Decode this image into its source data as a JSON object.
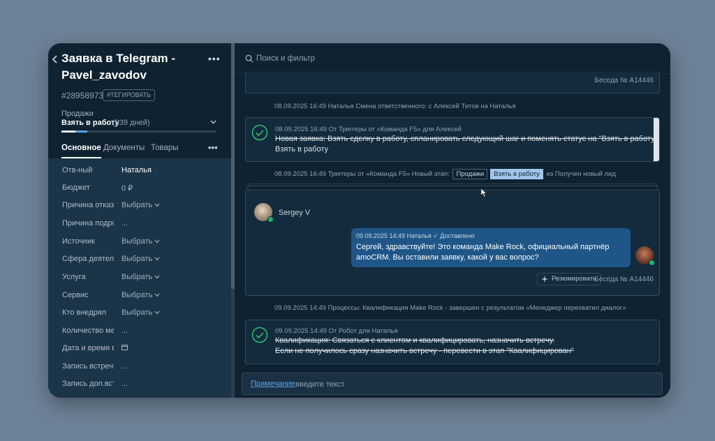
{
  "deal": {
    "title": "Заявка в Telegram - Pavel_zavodov",
    "id": "#28958973",
    "tag_button": "#ТЕГИРОВАТЬ",
    "pipeline": "Продажи",
    "stage": "Взять в работу",
    "stage_days": "(239 дней)",
    "more": "•••"
  },
  "tabs": [
    {
      "label": "Основное",
      "active": true
    },
    {
      "label": "Документы",
      "active": false
    },
    {
      "label": "Товары",
      "active": false
    }
  ],
  "tabs_more": "•••",
  "fields": [
    {
      "label": "Отв-ный",
      "value": "Наталья"
    },
    {
      "label": "Бюджет",
      "value": "0 ₽"
    },
    {
      "label": "Причина отказа",
      "value": "Выбрать"
    },
    {
      "label": "Причина подробно",
      "value": "..."
    },
    {
      "label": "Источник",
      "value": "Выбрать"
    },
    {
      "label": "Сфера деятельности",
      "value": "Выбрать"
    },
    {
      "label": "Услуга",
      "value": "Выбрать"
    },
    {
      "label": "Сервис",
      "value": "Выбрать"
    },
    {
      "label": "Кто внедрял",
      "value": "Выбрать"
    },
    {
      "label": "Количество менеджеров",
      "value": "..."
    },
    {
      "label": "Дата и время встречи",
      "value": ""
    },
    {
      "label": "Запись встречи",
      "value": "..."
    },
    {
      "label": "Запись доп.встречи",
      "value": "..."
    }
  ],
  "search": {
    "placeholder": "Поиск и фильтр"
  },
  "feed": {
    "top_conv_ref": "Беседа № A14446",
    "event1": "08.09.2025 16:49 Наталья Смена ответственного: с Алексей Титов на Наталья",
    "task1": {
      "meta": "08.09.2025 16:49  От Триггеры от «Команда F5» для Алексей",
      "text": "Новая заявка: Взять сделку в работу, спланировать следующий шаг и поменять статус на \"Взять в работу\"",
      "result": "Взять в работу"
    },
    "event2": {
      "prefix": "08.09.2025 16:49 Триггеры от «Команда F5» Новый этап:",
      "pipeline": "Продажи",
      "stage": "Взять в работу",
      "suffix": "из Получен новый лид"
    },
    "chat": {
      "sender": "Sergey V",
      "meta": "09.09.2025 14:49 Наталья  ✓ Доставлено",
      "text": "Сергей, здравствуйте! Это команда Make Rock, официальный партнёр amoCRM. Вы оставили заявку, какой у вас вопрос?",
      "summarize": "Резюмировать",
      "conv_ref": "Беседа № A14446"
    },
    "event3": "09.09.2025 14:49 Процессы: Квалификация Make Rock - завершен с результатом «Менеджер перехватил диалог»",
    "task2": {
      "meta": "09.09.2025 14:49  От Робот для Наталья",
      "line1": "Квалификация: Связаться с клиентом и квалифицировать, назначить встречу.",
      "line2": "Если не получилось сразу назначить встречу - перевести в этап \"Квалифицирован\""
    }
  },
  "note": {
    "link": "Примечание",
    "placeholder": "введите текст"
  }
}
